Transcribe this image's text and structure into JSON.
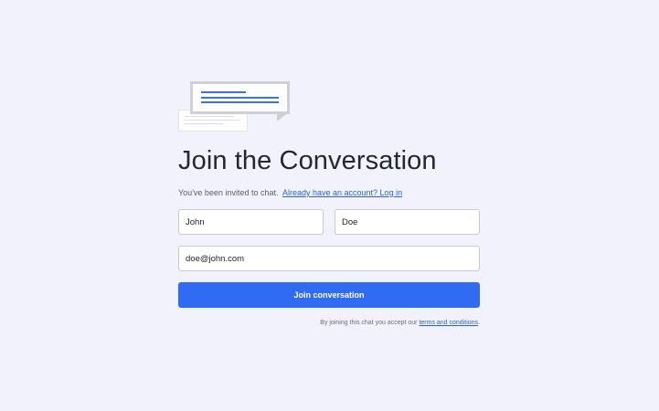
{
  "illustration": {
    "name": "chat-bubbles-illustration"
  },
  "heading": {
    "title": "Join the Conversation"
  },
  "invite": {
    "text": "You've been invited to chat.",
    "login_link": "Already have an account? Log in"
  },
  "form": {
    "first_name_value": "John",
    "last_name_value": "Doe",
    "email_value": "doe@john.com",
    "submit_label": "Join conversation"
  },
  "terms": {
    "prefix": "By joining this chat you accept our ",
    "link": "terms and conditions",
    "suffix": "."
  },
  "colors": {
    "background": "#f1f2fb",
    "accent": "#2f6bf3",
    "link": "#2d63d8"
  }
}
